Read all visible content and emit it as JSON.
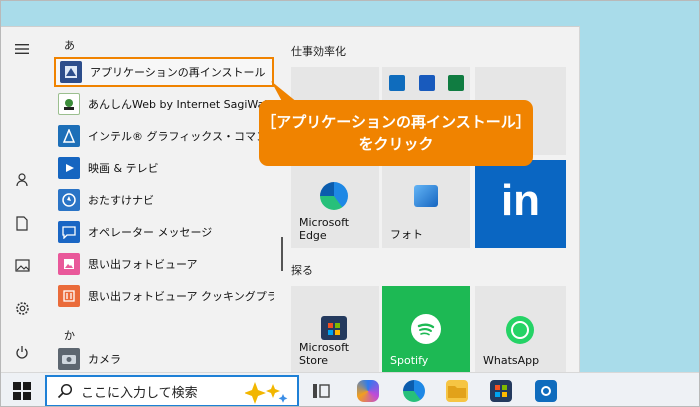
{
  "sections": {
    "a": "あ",
    "ka": "か"
  },
  "apps": [
    {
      "label": "アプリケーションの再インストール",
      "highlight": true
    },
    {
      "label": "あんしんWeb by Internet SagiWall for"
    },
    {
      "label": "インテル® グラフィックス・コマンド・センター"
    },
    {
      "label": "映画 & テレビ"
    },
    {
      "label": "おたすけナビ"
    },
    {
      "label": "オペレーター メッセージ"
    },
    {
      "label": "思い出フォトビューア"
    },
    {
      "label": "思い出フォトビューア クッキングプラス"
    },
    {
      "label": "カメラ"
    }
  ],
  "groups": {
    "productivity": "仕事効率化",
    "explore": "探る"
  },
  "tiles": {
    "edge": "Microsoft Edge",
    "photos": "フォト",
    "store": "Microsoft Store",
    "spotify": "Spotify",
    "whatsapp": "WhatsApp",
    "linkedin": "in"
  },
  "callout": {
    "line1": "［アプリケーションの再インストール］",
    "line2": "をクリック"
  },
  "taskbar": {
    "search_placeholder": "ここに入力して検索"
  }
}
